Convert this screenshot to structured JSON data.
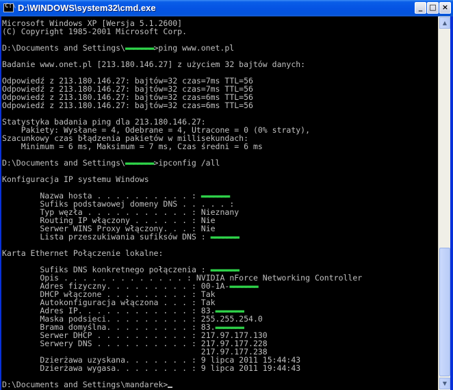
{
  "window": {
    "title": "D:\\WINDOWS\\system32\\cmd.exe",
    "icon_label": "C:\\",
    "controls": {
      "minimize": "_",
      "maximize": "□",
      "close": "×"
    }
  },
  "console": {
    "masked_text": "▬▬▬▬▬▬▬",
    "lines": [
      "Microsoft Windows XP [Wersja 5.1.2600]",
      "(C) Copyright 1985-2001 Microsoft Corp.",
      "",
      "D:\\Documents and Settings\\",
      "",
      "Badanie www.onet.pl [213.180.146.27] z użyciem 32 bajtów danych:",
      "",
      "Odpowiedź z 213.180.146.27: bajtów=32 czas=7ms TTL=56",
      "Odpowiedź z 213.180.146.27: bajtów=32 czas=7ms TTL=56",
      "Odpowiedź z 213.180.146.27: bajtów=32 czas=6ms TTL=56",
      "Odpowiedź z 213.180.146.27: bajtów=32 czas=6ms TTL=56",
      "",
      "Statystyka badania ping dla 213.180.146.27:",
      "    Pakiety: Wysłane = 4, Odebrane = 4, Utracone = 0 (0% straty),",
      "Szacunkowy czas błądzenia pakietów w millisekundach:",
      "    Minimum = 6 ms, Maksimum = 7 ms, Czas średni = 6 ms",
      "",
      "D:\\Documents and Settings\\",
      "",
      "Konfiguracja IP systemu Windows",
      "",
      "        Nazwa hosta . . . . . . . . . . : ",
      "        Sufiks podstawowej domeny DNS . . . . . :",
      "        Typ węzła . . . . . . . . . . . : Nieznany",
      "        Routing IP włączony . . . . . . : Nie",
      "        Serwer WINS Proxy włączony. . . : Nie",
      "        Lista przeszukiwania sufiksów DNS : ",
      "",
      "Karta Ethernet Połączenie lokalne:",
      "",
      "        Sufiks DNS konkretnego połączenia : ",
      "        Opis . . . . . . . . . . . . . : NVIDIA nForce Networking Controller",
      "        Adres fizyczny. . . . . . . . . : 00-1A-",
      "        DHCP włączone . . . . . . . . . : Tak",
      "        Autokonfiguracja włączona . . . : Tak",
      "        Adres IP. . . . . . . . . . . . : 83.",
      "        Maska podsieci. . . . . . . . . : 255.255.254.0",
      "        Brama domyślna. . . . . . . . . : 83.",
      "        Serwer DHCP . . . . . . . . . . : 217.97.177.130",
      "        Serwery DNS . . . . . . . . . . : 217.97.177.228",
      "                                          217.97.177.238",
      "        Dzierżawa uzyskana. . . . . . . : 9 lipca 2011 15:44:43",
      "        Dzierżawa wygasa. . . . . . . . : 9 lipca 2011 19:44:43",
      "",
      "D:\\Documents and Settings\\mandarek>"
    ],
    "line_suffixes": {
      "3": "ping www.onet.pl",
      "17": "ipconfig /all",
      "21": "",
      "26": "",
      "30": "",
      "32": "",
      "35": "",
      "37": ""
    }
  },
  "scrollbar": {
    "up_glyph": "▲",
    "down_glyph": "▼"
  }
}
